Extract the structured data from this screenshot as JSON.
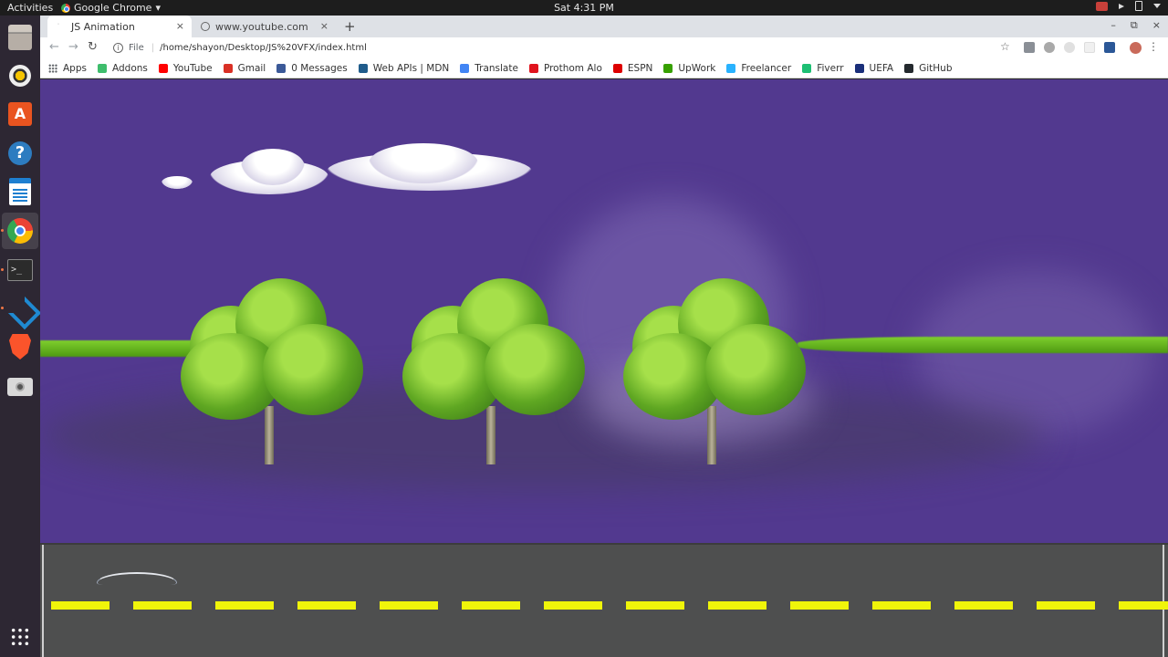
{
  "topbar": {
    "activities": "Activities",
    "app_name": "Google Chrome",
    "app_caret": "▾",
    "clock": "Sat  4:31 PM"
  },
  "dock": {
    "items": [
      "files-icon",
      "rhythmbox-icon",
      "software-icon",
      "help-icon",
      "writer-icon",
      "chrome-icon",
      "terminal-icon",
      "vscode-icon",
      "brave-icon",
      "camera-icon"
    ],
    "apps_grid": "show-applications-icon",
    "running_color": "#f07746"
  },
  "browser": {
    "tabs": [
      {
        "title": "JS Animation",
        "close": "×"
      },
      {
        "title": "www.youtube.com",
        "close": "×"
      }
    ],
    "new_tab": "+",
    "window_controls": {
      "minimize": "–",
      "maximize": "⧉",
      "close": "×"
    },
    "nav": {
      "back": "←",
      "forward": "→",
      "reload": "↻"
    },
    "omnibox": {
      "info": "i",
      "scheme": "File",
      "separator": "|",
      "url": "/home/shayon/Desktop/JS%20VFX/index.html"
    },
    "star": "☆",
    "menu": "⋮",
    "bookmarks": [
      {
        "label": "Apps",
        "color": "#5f6368"
      },
      {
        "label": "Addons",
        "color": "#3ebd6c"
      },
      {
        "label": "YouTube",
        "color": "#ff0000"
      },
      {
        "label": "Gmail",
        "color": "#d93025"
      },
      {
        "label": "0 Messages",
        "color": "#3b5998"
      },
      {
        "label": "Web APIs | MDN",
        "color": "#1f5c8b"
      },
      {
        "label": "Translate",
        "color": "#4285f4"
      },
      {
        "label": "Prothom Alo",
        "color": "#e0141e"
      },
      {
        "label": "ESPN",
        "color": "#d00"
      },
      {
        "label": "UpWork",
        "color": "#37a000"
      },
      {
        "label": "Freelancer",
        "color": "#29b2fe"
      },
      {
        "label": "Fiverr",
        "color": "#1dbf73"
      },
      {
        "label": "UEFA",
        "color": "#1a2f7a"
      },
      {
        "label": "GitHub",
        "color": "#24292e"
      }
    ]
  },
  "scene": {
    "sky_color": "#52398f",
    "road_color": "#4e4f4f",
    "dash_color": "#f0f50a",
    "dash_count": 14
  }
}
